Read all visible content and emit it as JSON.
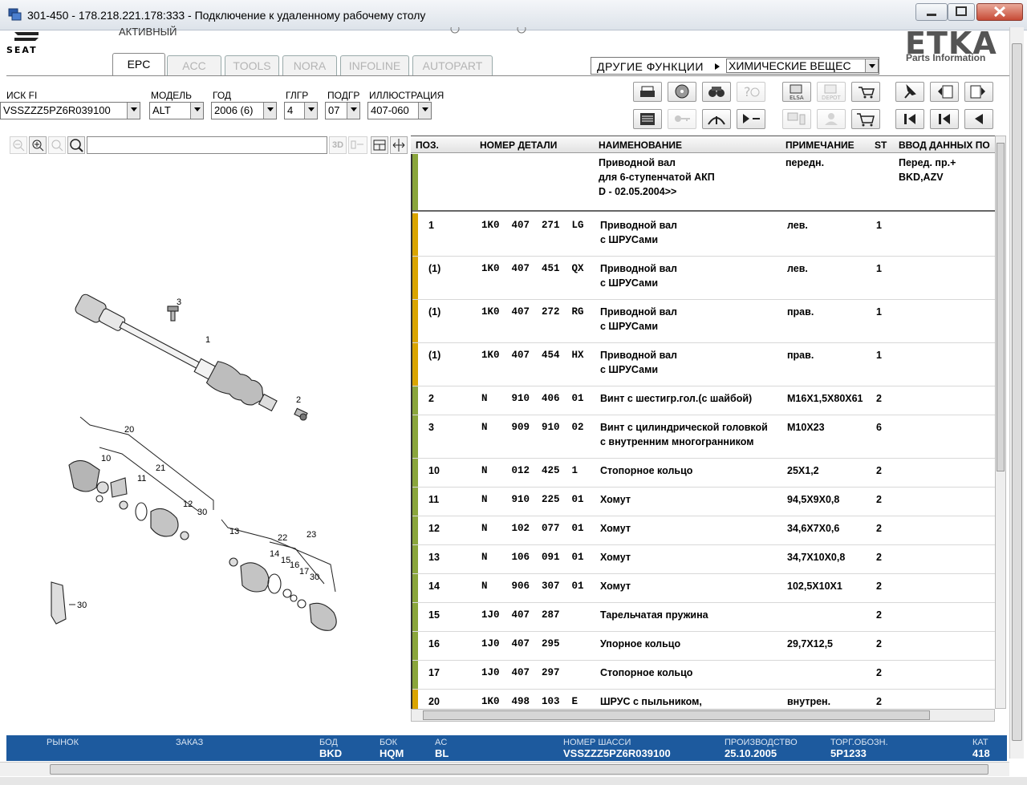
{
  "window": {
    "title": "301-450 - 178.218.221.178:333 - Подключение к удаленному рабочему столу"
  },
  "header": {
    "brand": "SEAT",
    "active_label": "АКТИВНЫЙ",
    "etka_logo": "ETKA",
    "etka_sub": "Parts Information"
  },
  "tabs": [
    {
      "label": "EPC",
      "active": true
    },
    {
      "label": "ACC",
      "active": false
    },
    {
      "label": "TOOLS",
      "active": false
    },
    {
      "label": "NORA",
      "active": false
    },
    {
      "label": "INFOLINE",
      "active": false
    },
    {
      "label": "AUTOPART",
      "active": false
    }
  ],
  "other_functions": {
    "label": "ДРУГИЕ ФУНКЦИИ",
    "selected": "ХИМИЧЕСКИЕ ВЕЩЕС"
  },
  "fields": {
    "vin": {
      "label": "ИСК FI",
      "value": "VSSZZZ5PZ6R039100"
    },
    "model": {
      "label": "МОДЕЛЬ",
      "value": "ALT"
    },
    "year": {
      "label": "ГОД",
      "value": "2006 (6)"
    },
    "main_group": {
      "label": "ГЛГР",
      "value": "4"
    },
    "sub_group": {
      "label": "ПОДГР",
      "value": "07"
    },
    "illustration": {
      "label": "ИЛЛЮСТРАЦИЯ",
      "value": "407-060"
    }
  },
  "toolbar": {
    "elsa_label": "ELSA",
    "depot_label": "DEPOT",
    "toolbar_3d": "3D"
  },
  "grid": {
    "columns": [
      "ПОЗ.",
      "НОМЕР ДЕТАЛИ",
      "НАИМЕНОВАНИЕ",
      "ПРИМЕЧАНИЕ",
      "ST",
      "ВВОД ДАННЫХ ПО"
    ],
    "header_row": {
      "name": "Приводной вал\nдля 6-ступенчатой АКП\nD - 02.05.2004>>",
      "note": "передн.",
      "input": "Перед. пр.+\nBKD,AZV"
    },
    "rows": [
      {
        "pos": "1",
        "part": "1K0  407  271  LG",
        "name": "Приводной вал\nс ШРУСами",
        "note": "лев.",
        "st": "1",
        "accent": "#d9a400"
      },
      {
        "pos": "(1)",
        "part": "1K0  407  451  QX",
        "name": "Приводной вал\nс ШРУСами",
        "note": "лев.",
        "st": "1",
        "accent": "#d9a400"
      },
      {
        "pos": "(1)",
        "part": "1K0  407  272  RG",
        "name": "Приводной вал\nс ШРУСами",
        "note": "прав.",
        "st": "1",
        "accent": "#d9a400"
      },
      {
        "pos": "(1)",
        "part": "1K0  407  454  HX",
        "name": "Приводной вал\nс ШРУСами",
        "note": "прав.",
        "st": "1",
        "accent": "#d9a400"
      },
      {
        "pos": "2",
        "part": "N    910  406  01",
        "name": "Винт с шестигр.гол.(с шайбой)",
        "note": "M16X1,5X80X61",
        "st": "2",
        "accent": "#8aa53b"
      },
      {
        "pos": "3",
        "part": "N    909  910  02",
        "name": "Винт с цилиндрической головкой\nс внутренним многогранником",
        "note": "M10X23",
        "st": "6",
        "accent": "#8aa53b"
      },
      {
        "pos": "10",
        "part": "N    012  425  1",
        "name": "Стопорное кольцо",
        "note": "25X1,2",
        "st": "2",
        "accent": "#8aa53b"
      },
      {
        "pos": "11",
        "part": "N    910  225  01",
        "name": "Хомут",
        "note": "94,5X9X0,8",
        "st": "2",
        "accent": "#8aa53b"
      },
      {
        "pos": "12",
        "part": "N    102  077  01",
        "name": "Хомут",
        "note": "34,6X7X0,6",
        "st": "2",
        "accent": "#8aa53b"
      },
      {
        "pos": "13",
        "part": "N    106  091  01",
        "name": "Хомут",
        "note": "34,7X10X0,8",
        "st": "2",
        "accent": "#8aa53b"
      },
      {
        "pos": "14",
        "part": "N    906  307  01",
        "name": "Хомут",
        "note": "102,5X10X1",
        "st": "2",
        "accent": "#8aa53b"
      },
      {
        "pos": "15",
        "part": "1J0  407  287",
        "name": "Тарельчатая пружина",
        "note": "",
        "st": "2",
        "accent": "#8aa53b"
      },
      {
        "pos": "16",
        "part": "1J0  407  295",
        "name": "Упорное кольцо",
        "note": "29,7X12,5",
        "st": "2",
        "accent": "#8aa53b"
      },
      {
        "pos": "17",
        "part": "1J0  407  297",
        "name": "Стопорное кольцо",
        "note": "",
        "st": "2",
        "accent": "#8aa53b"
      },
      {
        "pos": "20",
        "part": "1K0  498  103  E",
        "name": "ШРУС с пыльником,",
        "note": "внутрен.",
        "st": "2",
        "accent": "#d9a400"
      }
    ]
  },
  "illustration_labels": [
    "3",
    "1",
    "2",
    "20",
    "10",
    "21",
    "11",
    "12",
    "30",
    "13",
    "22",
    "23",
    "14",
    "15",
    "16",
    "17",
    "30",
    "30"
  ],
  "status": {
    "market": {
      "label": "РЫНОК",
      "value": ""
    },
    "order": {
      "label": "ЗАКАЗ",
      "value": ""
    },
    "bod": {
      "label": "БОД",
      "value": "BKD"
    },
    "bok": {
      "label": "БОК",
      "value": "HQM"
    },
    "ac": {
      "label": "AC",
      "value": "BL"
    },
    "chassis": {
      "label": "НОМЕР ШАССИ",
      "value": "VSSZZZ5PZ6R039100"
    },
    "production": {
      "label": "ПРОИЗВОДСТВО",
      "value": "25.10.2005"
    },
    "trade": {
      "label": "ТОРГ.ОБОЗН.",
      "value": "5P1233"
    },
    "cat": {
      "label": "КАТ",
      "value": "418"
    }
  },
  "colors": {
    "status_bg": "#1d5a9e",
    "accent_yellow": "#d9a400",
    "accent_green": "#8aa53b"
  }
}
